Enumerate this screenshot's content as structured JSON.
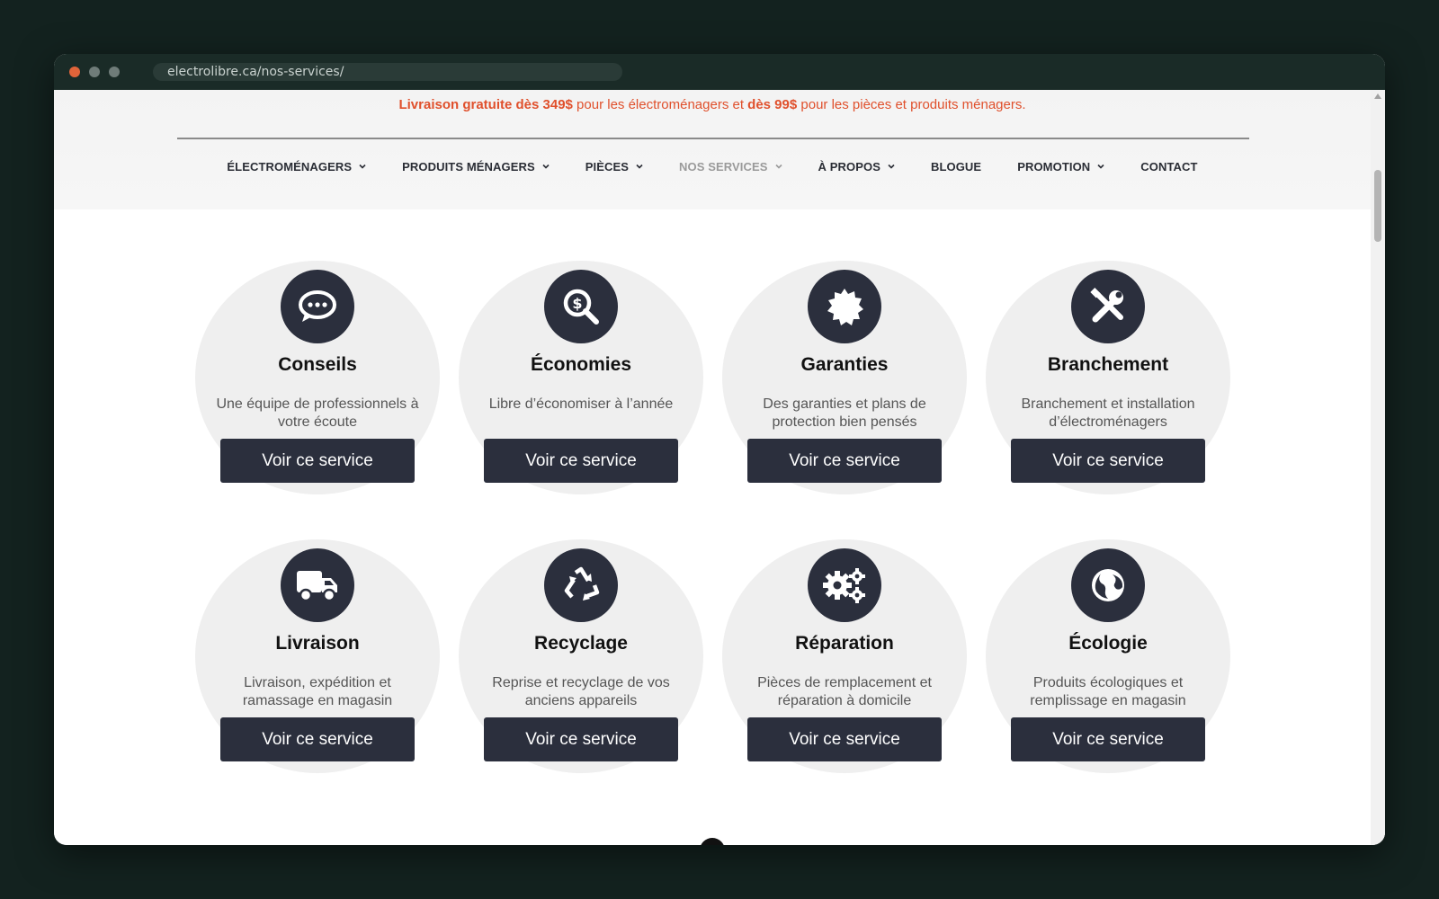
{
  "browser": {
    "url": "electrolibre.ca/nos-services/"
  },
  "promo": {
    "part1": "Livraison gratuite dès 349$",
    "part2": " pour les électroménagers et ",
    "part3": "dès 99$",
    "part4": " pour les pièces et produits ménagers."
  },
  "nav": {
    "items": [
      {
        "label": "ÉLECTROMÉNAGERS",
        "dropdown": true
      },
      {
        "label": "PRODUITS MÉNAGERS",
        "dropdown": true
      },
      {
        "label": "PIÈCES",
        "dropdown": true
      },
      {
        "label": "NOS SERVICES",
        "dropdown": true,
        "active": true
      },
      {
        "label": "À PROPOS",
        "dropdown": true
      },
      {
        "label": "BLOGUE",
        "dropdown": false
      },
      {
        "label": "PROMOTION",
        "dropdown": true
      },
      {
        "label": "CONTACT",
        "dropdown": false
      }
    ]
  },
  "services": [
    {
      "icon": "chat-bubble-icon",
      "title": "Conseils",
      "desc_line1": "Une équipe de professionnels à",
      "desc_line2": "votre écoute",
      "button": "Voir ce service"
    },
    {
      "icon": "dollar-magnifier-icon",
      "title": "Économies",
      "desc_line1": "Libre d’économiser à l’année",
      "desc_line2": "",
      "button": "Voir ce service"
    },
    {
      "icon": "badge-certificate-icon",
      "title": "Garanties",
      "desc_line1": "Des garanties et plans de",
      "desc_line2": "protection bien pensés",
      "button": "Voir ce service"
    },
    {
      "icon": "wrench-screwdriver-icon",
      "title": "Branchement",
      "desc_line1": "Branchement et installation",
      "desc_line2": "d’électroménagers",
      "button": "Voir ce service"
    },
    {
      "icon": "truck-icon",
      "title": "Livraison",
      "desc_line1": "Livraison, expédition et",
      "desc_line2": "ramassage en magasin",
      "button": "Voir ce service"
    },
    {
      "icon": "recycle-icon",
      "title": "Recyclage",
      "desc_line1": "Reprise et recyclage de vos",
      "desc_line2": "anciens appareils",
      "button": "Voir ce service"
    },
    {
      "icon": "gears-icon",
      "title": "Réparation",
      "desc_line1": "Pièces de remplacement et",
      "desc_line2": "réparation à domicile",
      "button": "Voir ce service"
    },
    {
      "icon": "globe-icon",
      "title": "Écologie",
      "desc_line1": "Produits écologiques et",
      "desc_line2": "remplissage en magasin",
      "button": "Voir ce service"
    }
  ],
  "colors": {
    "promo": "#e0502c",
    "dark": "#2b2f3d",
    "disc": "#efefef",
    "active_nav": "#9a9a9a"
  }
}
